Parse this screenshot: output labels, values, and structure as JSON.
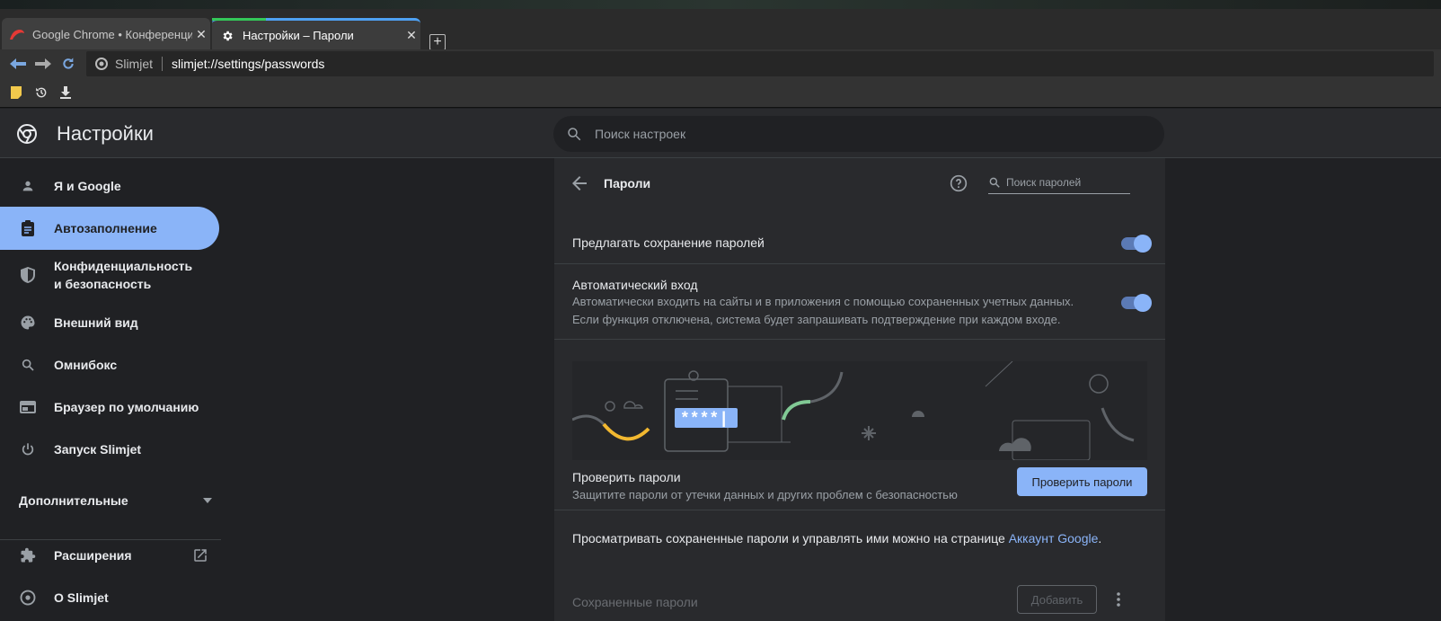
{
  "browser": {
    "tabs": [
      {
        "title": "Google Chrome • Конференция G",
        "close": "✕"
      },
      {
        "title": "Настройки – Пароли",
        "close": "✕"
      }
    ],
    "new_tab": "+",
    "omnibox": {
      "site": "Slimjet",
      "url": "slimjet://settings/passwords"
    }
  },
  "settings": {
    "title": "Настройки",
    "search_placeholder": "Поиск настроек",
    "sidebar": [
      {
        "label": "Я и Google",
        "icon": "person-icon"
      },
      {
        "label": "Автозаполнение",
        "icon": "clipboard-icon",
        "active": true
      },
      {
        "label": "Конфиденциальность и безопасность",
        "icon": "shield-icon"
      },
      {
        "label": "Внешний вид",
        "icon": "palette-icon"
      },
      {
        "label": "Омнибокс",
        "icon": "search-icon"
      },
      {
        "label": "Браузер по умолчанию",
        "icon": "browser-icon"
      },
      {
        "label": "Запуск Slimjet",
        "icon": "power-icon"
      }
    ],
    "advanced": "Дополнительные",
    "extensions": "Расширения",
    "about": "О Slimjet"
  },
  "passwords": {
    "heading": "Пароли",
    "search_placeholder": "Поиск паролей",
    "offer_save": {
      "label": "Предлагать сохранение паролей",
      "enabled": true
    },
    "auto_signin": {
      "label": "Автоматический вход",
      "description": "Автоматически входить на сайты и в приложения с помощью сохраненных учетных данных. Если функция отключена, система будет запрашивать подтверждение при каждом входе.",
      "enabled": true
    },
    "illustration_text": "****|",
    "check": {
      "label": "Проверить пароли",
      "description": "Защитите пароли от утечки данных и других проблем с безопасностью",
      "button": "Проверить пароли"
    },
    "manage_text": "Просматривать сохраненные пароли и управлять ими можно на странице ",
    "manage_link": "Аккаунт Google",
    "manage_end": ".",
    "saved_label": "Сохраненные пароли",
    "add_button": "Добавить"
  },
  "colors": {
    "accent": "#8ab4f8",
    "background": "#202124",
    "surface": "#292a2d"
  }
}
